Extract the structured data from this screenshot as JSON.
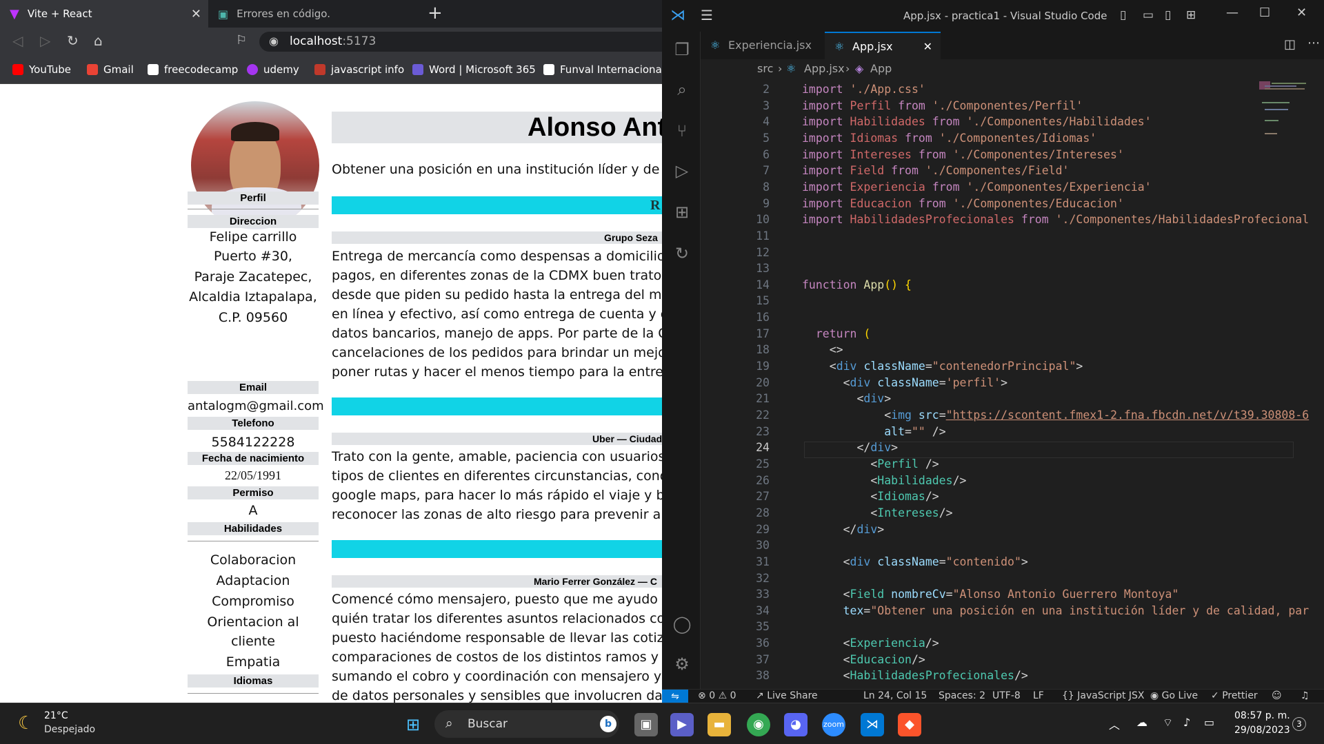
{
  "browser": {
    "tabs": [
      {
        "title": "Vite + React",
        "active": true
      },
      {
        "title": "Errores en código.",
        "active": false
      }
    ],
    "url_host": "localhost",
    "url_port": ":5173",
    "bookmarks": [
      {
        "label": "YouTube",
        "icon": "youtube-icon",
        "color": "#ff0000"
      },
      {
        "label": "Gmail",
        "icon": "gmail-icon",
        "color": "#ea4335"
      },
      {
        "label": "freecodecamp",
        "icon": "freecodecamp-icon",
        "color": "#ffffff"
      },
      {
        "label": "udemy",
        "icon": "udemy-icon",
        "color": "#a435f0"
      },
      {
        "label": "javascript info",
        "icon": "javascript-info-icon",
        "color": "#c0392b"
      },
      {
        "label": "Word | Microsoft 365",
        "icon": "word-icon",
        "color": "#6b5bd6"
      },
      {
        "label": "Funval Internacional",
        "icon": "funval-icon",
        "color": "#ffffff"
      }
    ]
  },
  "cv": {
    "name": "Alonso Anto",
    "objective": "Obtener una posición en una institución líder y de ca",
    "left": {
      "perfil": "Perfil",
      "direccion_label": "Direccion",
      "direccion_lines": [
        "Felipe carrillo",
        "Puerto #30,",
        "Paraje Zacatepec,",
        "Alcaldia Iztapalapa,",
        "C.P. 09560"
      ],
      "email_label": "Email",
      "email": "antalogm@gmail.com",
      "telefono_label": "Telefono",
      "telefono": "5584122228",
      "fecha_label": "Fecha de nacimiento",
      "fecha": "22/05/1991",
      "permiso_label": "Permiso",
      "permiso": "A",
      "habilidades_label": "Habilidades",
      "habilidades": [
        "Colaboracion",
        "Adaptacion",
        "Compromiso",
        "Orientacion al",
        "cliente",
        "Empatia"
      ],
      "idiomas_label": "Idiomas"
    },
    "section_letter": "R",
    "jobs": [
      {
        "header": "Grupo Seza",
        "lines": [
          "Entrega de mercancía como despensas a domicilio, t",
          "pagos, en diferentes zonas de la CDMX buen trato,",
          "desde que piden su pedido hasta la entrega del mism",
          "en línea y efectivo, así como entrega de cuenta y en",
          "datos bancarios, manejo de apps. Por parte de la Co",
          "cancelaciones de los pedidos para brindar un mejor",
          "poner rutas y hacer el menos tiempo para la entrega"
        ]
      },
      {
        "header": "Uber — Ciudad",
        "lines": [
          "Trato con la gente, amable, paciencia con usuarios e",
          "tipos de clientes en diferentes circunstancias, cono",
          "google maps, para hacer lo más rápido el viaje y bus",
          "reconocer las zonas de alto riesgo para prevenir alg"
        ]
      },
      {
        "header": "Mario Ferrer González — C",
        "lines": [
          "Comencé cómo mensajero, puesto que me ayudo a co",
          "quién tratar los diferentes asuntos relacionados con",
          "puesto haciéndome responsable de llevar las cotizac",
          "comparaciones de costos de los distintos ramos y as",
          "sumando el cobro y coordinación con mensajero y cl",
          "de datos personales y sensibles que involucren dato"
        ]
      }
    ]
  },
  "vscode": {
    "title": "App.jsx - practica1 - Visual Studio Code",
    "tabs": [
      "Experiencia.jsx",
      "App.jsx"
    ],
    "breadcrumb": [
      "src",
      "App.jsx",
      "App"
    ],
    "status": {
      "errors": "0",
      "warnings": "0",
      "live_share": "Live Share",
      "position": "Ln 24, Col 15",
      "spaces": "Spaces: 2",
      "encoding": "UTF-8",
      "eol": "LF",
      "language": "JavaScript JSX",
      "go_live": "Go Live",
      "prettier": "Prettier"
    },
    "line_numbers": [
      "2",
      "3",
      "4",
      "5",
      "6",
      "7",
      "8",
      "9",
      "10",
      "11",
      "12",
      "13",
      "14",
      "15",
      "16",
      "17",
      "18",
      "19",
      "20",
      "21",
      "22",
      "23",
      "24",
      "25",
      "26",
      "27",
      "28",
      "29",
      "30",
      "31",
      "32",
      "33",
      "34",
      "35",
      "36",
      "37",
      "38"
    ]
  },
  "taskbar": {
    "weather_temp": "21°C",
    "weather_desc": "Despejado",
    "search": "Buscar",
    "time": "08:57 p. m.",
    "date": "29/08/2023",
    "notifications": "3"
  }
}
